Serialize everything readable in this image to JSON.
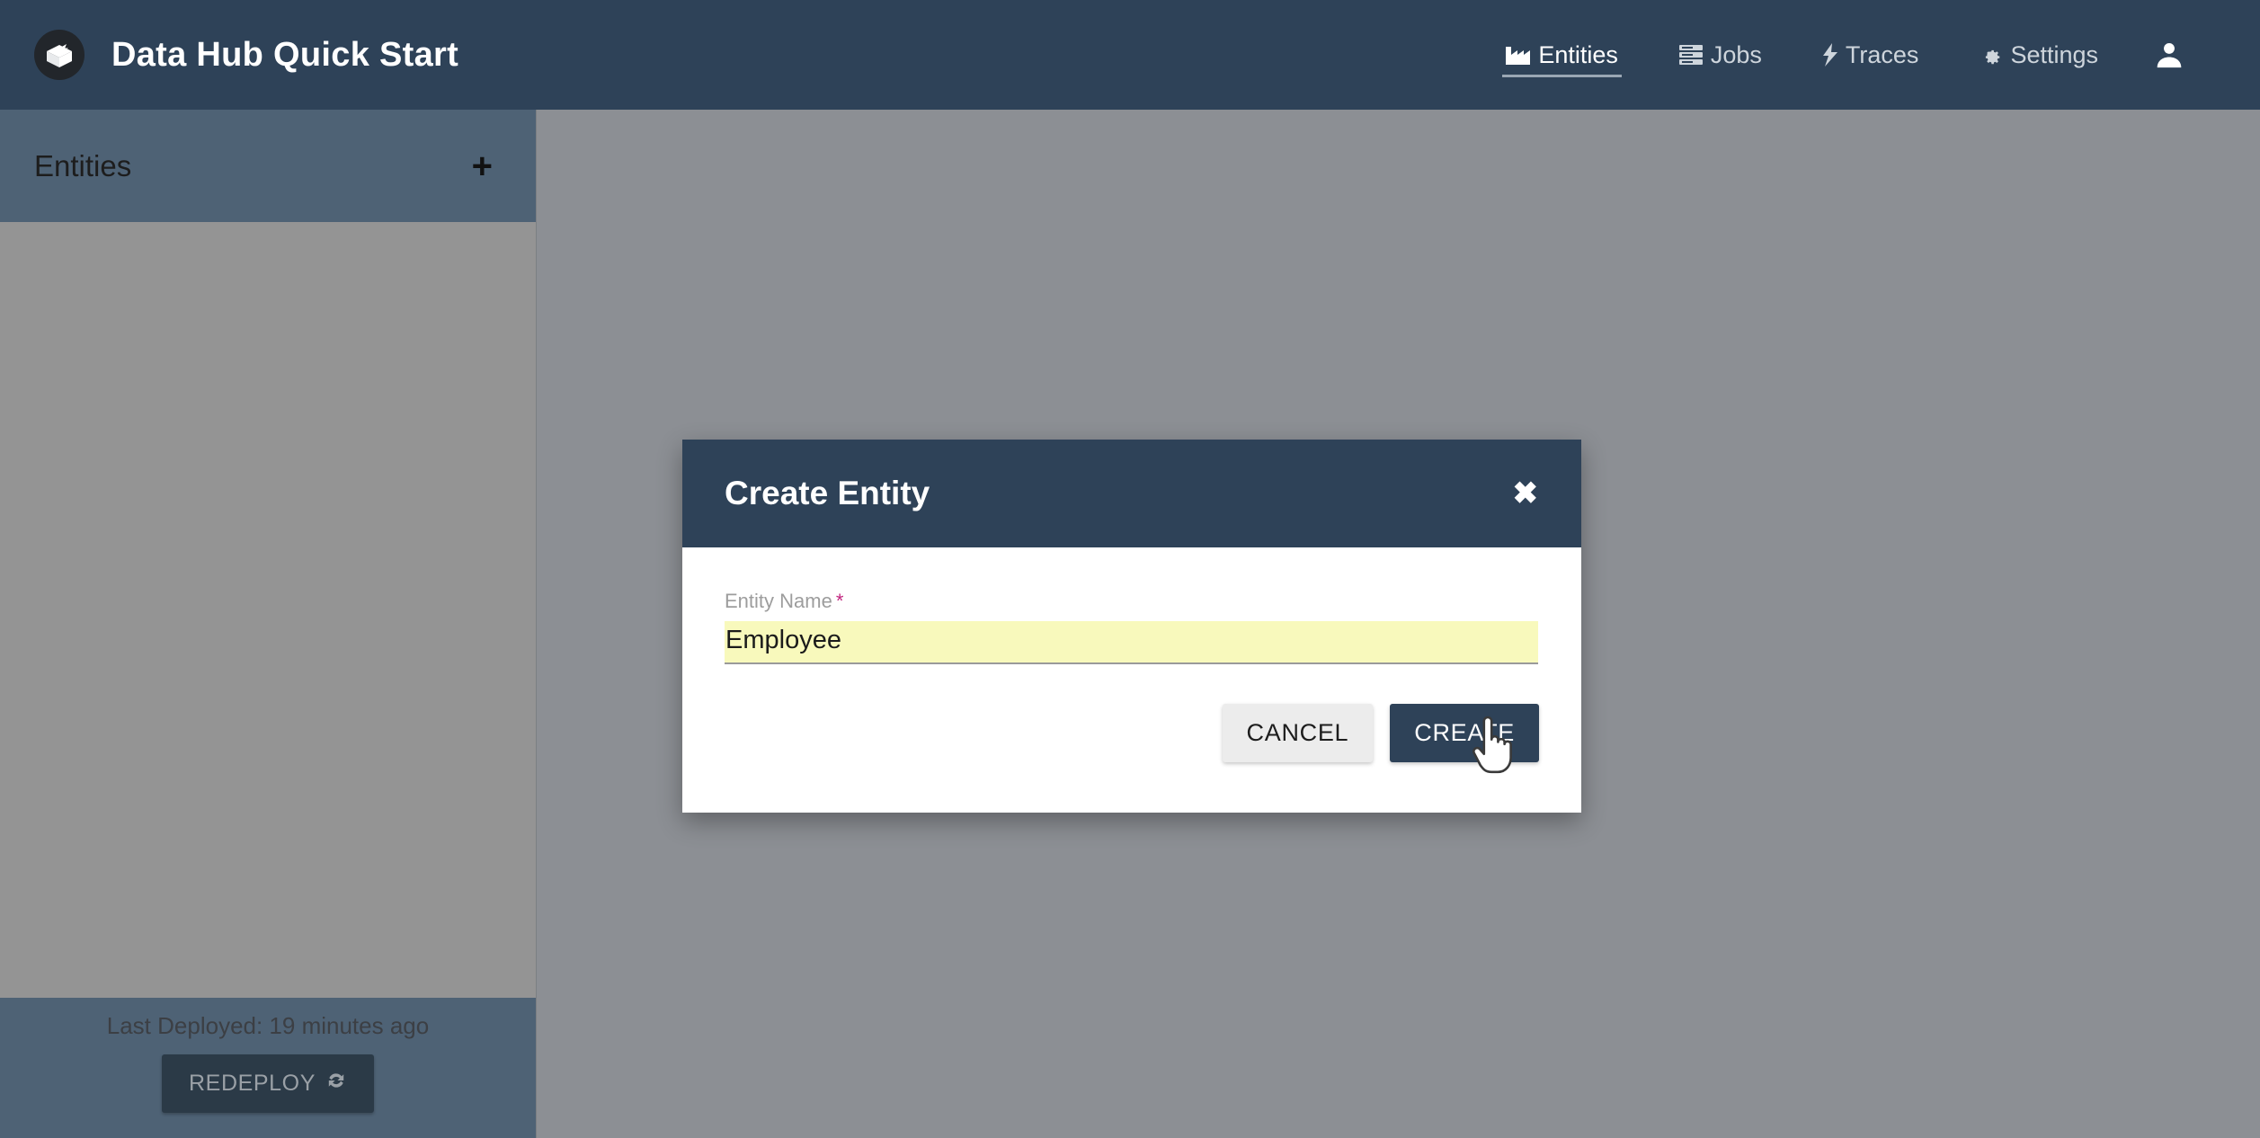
{
  "header": {
    "logo_icon": "marklogic-box-logo",
    "title": "Data Hub Quick Start",
    "nav": [
      {
        "label": "Entities",
        "icon": "factory-icon",
        "active": true
      },
      {
        "label": "Jobs",
        "icon": "server-stack-icon",
        "active": false
      },
      {
        "label": "Traces",
        "icon": "bolt-icon",
        "active": false
      },
      {
        "label": "Settings",
        "icon": "gear-icon",
        "active": false
      }
    ],
    "user_icon": "user-avatar-icon"
  },
  "sidebar": {
    "title": "Entities",
    "add_label": "+",
    "footer": {
      "deploy_status": "Last Deployed: 19 minutes ago",
      "redeploy_label": "REDEPLOY",
      "redeploy_icon": "refresh-icon"
    }
  },
  "modal": {
    "title": "Create Entity",
    "close_label": "✖",
    "field": {
      "label": "Entity Name",
      "required_marker": "*",
      "value": "Employee",
      "placeholder": ""
    },
    "cancel_label": "CANCEL",
    "create_label": "CREATE"
  },
  "colors": {
    "nav_bg": "#2e4258",
    "sidebar_header_bg": "#4e6275",
    "overlay_bg": "#8c8f94",
    "required_star": "#c2257f",
    "input_autofill": "#f8f9bc",
    "primary_button": "#2e4258"
  }
}
